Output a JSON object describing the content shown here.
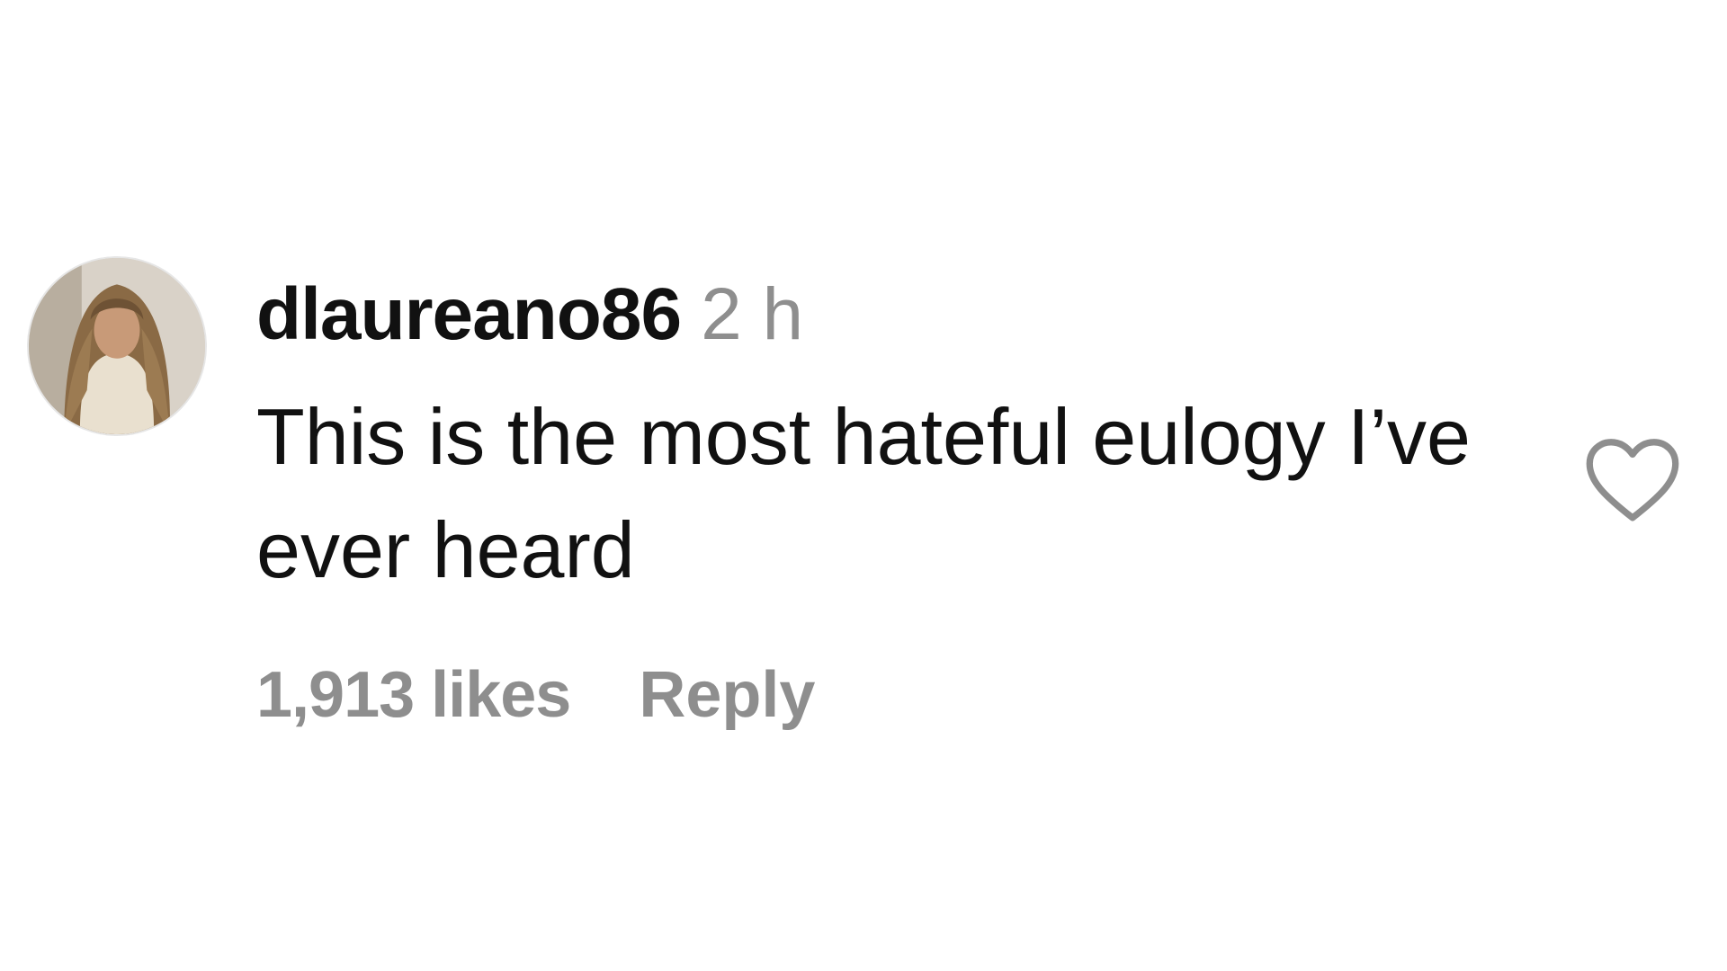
{
  "comment": {
    "username": "dlaureano86",
    "time": "2 h",
    "text": "This is the most hateful eulogy I’ve ever heard",
    "likes": "1,913 likes",
    "reply_label": "Reply"
  },
  "icons": {
    "like": "heart-outline-icon",
    "avatar": "user-avatar"
  },
  "colors": {
    "text": "#111111",
    "muted": "#8e8e8e",
    "icon": "#8e8e8e",
    "background": "#ffffff"
  }
}
